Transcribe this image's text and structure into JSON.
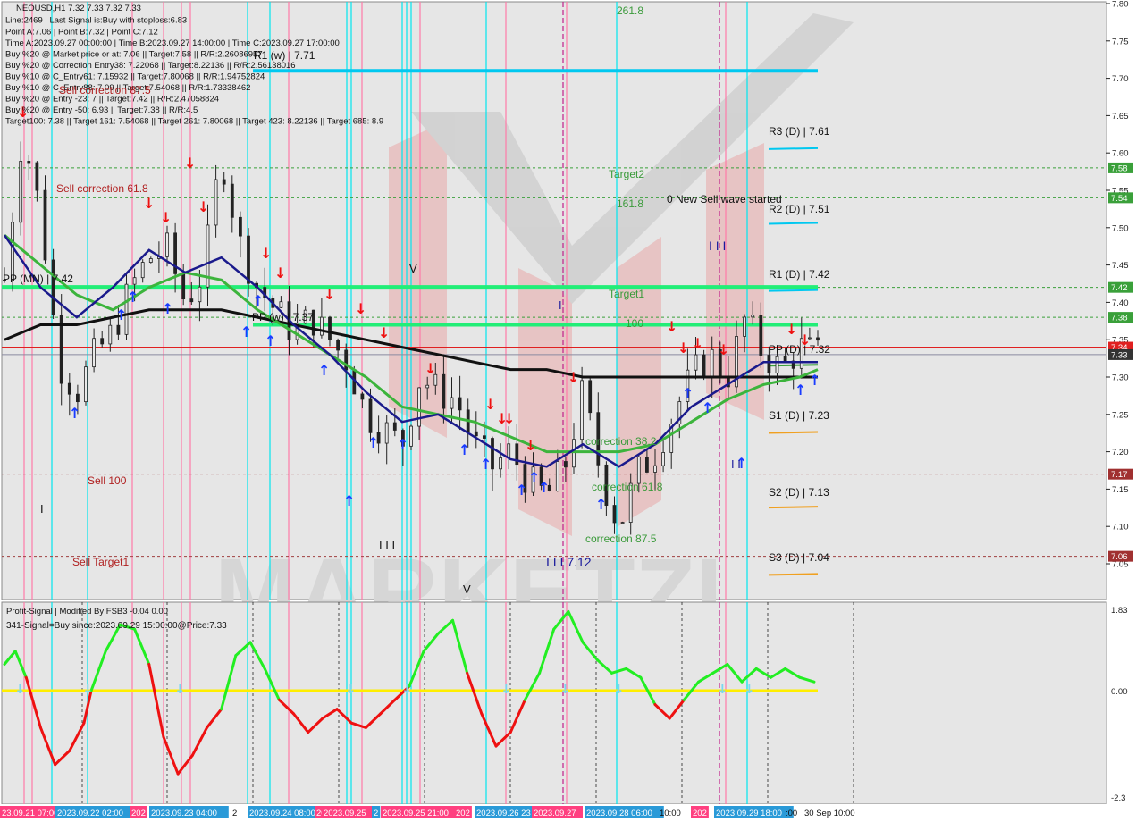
{
  "colors": {
    "background": "#ffffff",
    "pane_bg": "#e3e3e3",
    "ema_fast": "#1a1a8c",
    "ema_mid": "#3cb43c",
    "ema_slow": "#111111",
    "pivot_cyan": "#00c8f0",
    "level_green": "#22ee77",
    "red_line": "#e02020",
    "grey_line": "#8a8aa0",
    "osc_green": "#22ee22",
    "osc_red": "#ee1111",
    "osc_zero": "#ffee00",
    "vline_cyan": "#00e5ee",
    "vline_pink": "#ff7aa8",
    "vline_magenta": "#c0208a",
    "dotted_line": "#a04040"
  },
  "header": {
    "symbol_line": "NEOUSD,H1  7.32 7.33 7.32 7.33",
    "info_lines": [
      "Line:2469 | Last Signal is:Buy with stoploss:6.83",
      "Point A:7.06 | Point B:7.32 | Point C:7.12",
      "Time A:2023.09.27 00:00:00 | Time B:2023.09.27 14:00:00 | Time C:2023.09.27 17:00:00",
      "Buy %20 @ Market price or at: 7.06 || Target:7.58 || R/R:2.26086957",
      "Buy %20 @ Correction Entry38: 7.22068 || Target:8.22136 || R/R:2.56138016",
      "Buy %10 @ C_Entry61: 7.15932 || Target:7.80068 || R/R:1.94752824",
      "Buy %10 @ C_Entry88: 7.09 || Target:7.54068 || R/R:1.73338462",
      "Buy %20 @ Entry -23: 7 || Target:7.42 || R/R:2.47058824",
      "Buy %20 @ Entry -50: 6.93 || Target:7.38 || R/R:4.5",
      "Target100: 7.38 || Target 161: 7.54068 || Target 261: 7.80068 || Target 423: 8.22136 || Target 685: 8.9"
    ]
  },
  "annotations": {
    "label_261": "261.8",
    "label_target2": "Target2",
    "label_1618": "161.8",
    "label_new_sell": "0 New Sell wave started",
    "label_target1": "Target1",
    "label_100": "100",
    "label_sell_corr_618": "Sell correction 61.8",
    "label_sell_corr_87": "Sell correction 87.5",
    "label_sell_100": "Sell 100",
    "label_sell_target1": "Sell Target1",
    "label_pp_mn": "PP (MN) | 7.42",
    "label_r1_w": "R1 (w) | 7.71",
    "label_pp_w": "PP (w) | 7.37",
    "label_r3_d": "R3 (D) | 7.61",
    "label_r2_d": "R2 (D) | 7.51",
    "label_r1_d": "R1 (D) | 7.42",
    "label_pp_d": "PP (D) | 7.32",
    "label_s1_d": "S1 (D) | 7.23",
    "label_s2_d": "S2 (D) | 7.13",
    "label_s3_d": "S3 (D) | 7.04",
    "label_corr_382": "correction 38.2",
    "label_corr_618": "correction 61.8",
    "label_corr_875": "correction 87.5",
    "label_wave_c": "I I I 7.12",
    "label_wave_iii": "I I I",
    "label_wave_iii_2": "I I I",
    "label_wave_v_top": "V",
    "label_wave_v_bot": "V",
    "label_wave_i": "I",
    "label_wave_ii": "I I",
    "label_tick_left": "I",
    "watermark": "MARKETZI"
  },
  "price_axis": {
    "ticks": [
      "7.80",
      "7.75",
      "7.70",
      "7.65",
      "7.60",
      "7.55",
      "7.50",
      "7.45",
      "7.40",
      "7.35",
      "7.30",
      "7.25",
      "7.20",
      "7.15",
      "7.10",
      "7.05"
    ],
    "badges": [
      {
        "label": "7.58",
        "color": "#3aa03a"
      },
      {
        "label": "7.54",
        "color": "#3aa03a"
      },
      {
        "label": "7.42",
        "color": "#3aa03a"
      },
      {
        "label": "7.38",
        "color": "#3aa03a"
      },
      {
        "label": "7.34",
        "color": "#e02020"
      },
      {
        "label": "7.33",
        "color": "#333333"
      },
      {
        "label": "7.17",
        "color": "#a03030"
      },
      {
        "label": "7.06",
        "color": "#a03030"
      }
    ]
  },
  "oscillator": {
    "title": "Profit-Signal | Modified By FSB3 -0.04 0.00",
    "signal_text": "341-Signal=Buy since:2023.09.29 15:00:00@Price:7.33",
    "axis_ticks": [
      "1.83",
      "0.00",
      "-2.3"
    ]
  },
  "time_axis": {
    "labels": [
      "23.09.21 07:00",
      "2023.09.22 02:00",
      "202",
      "2023.09.23 04:00",
      "2",
      "2023.09.24 08:00",
      "20",
      "2023.09.25",
      "2",
      "2023.09.25 21:00",
      "202",
      "2023.09.26 23",
      "2023.09.27",
      "2023.09.28 06:00",
      "10:00",
      "202",
      "2023.09.29 18:00",
      ":00",
      "30 Sep 10:00"
    ]
  },
  "chart_data": [
    {
      "type": "line",
      "title": "NEOUSD,H1",
      "xlabel": "",
      "ylabel": "",
      "ylim": [
        7.02,
        7.81
      ],
      "x_range": [
        0,
        225
      ],
      "grid": false,
      "series": [
        {
          "name": "NEOUSD,H1",
          "kind": "candles-close",
          "x": [
            0,
            5,
            10,
            15,
            20,
            25,
            30,
            35,
            40,
            45,
            50,
            55,
            60,
            65,
            70,
            75,
            80,
            85,
            90,
            95,
            100,
            105,
            110,
            115,
            120,
            125,
            130,
            135,
            140,
            145,
            150,
            155,
            160,
            165,
            170,
            175,
            180,
            185,
            190,
            195,
            200,
            205,
            210,
            215,
            220,
            225
          ],
          "values": [
            7.43,
            7.63,
            7.52,
            7.32,
            7.28,
            7.33,
            7.36,
            7.42,
            7.46,
            7.47,
            7.4,
            7.44,
            7.6,
            7.48,
            7.42,
            7.39,
            7.36,
            7.38,
            7.35,
            7.32,
            7.25,
            7.23,
            7.21,
            7.3,
            7.28,
            7.27,
            7.21,
            7.18,
            7.2,
            7.16,
            7.14,
            7.18,
            7.28,
            7.17,
            7.1,
            7.17,
            7.2,
            7.25,
            7.3,
            7.33,
            7.3,
            7.38,
            7.33,
            7.31,
            7.34,
            7.33
          ]
        },
        {
          "kind": "ema-fast",
          "x": [
            0,
            10,
            20,
            30,
            40,
            50,
            60,
            70,
            80,
            90,
            100,
            110,
            120,
            130,
            140,
            150,
            160,
            170,
            180,
            190,
            200,
            210,
            220,
            225
          ],
          "values": [
            7.49,
            7.42,
            7.38,
            7.42,
            7.47,
            7.44,
            7.46,
            7.42,
            7.37,
            7.33,
            7.28,
            7.24,
            7.25,
            7.22,
            7.19,
            7.18,
            7.21,
            7.18,
            7.21,
            7.26,
            7.29,
            7.32,
            7.32,
            7.32
          ]
        },
        {
          "kind": "ema-mid",
          "x": [
            0,
            10,
            20,
            30,
            40,
            50,
            60,
            70,
            80,
            90,
            100,
            110,
            120,
            130,
            140,
            150,
            160,
            170,
            180,
            190,
            200,
            210,
            220,
            225
          ],
          "values": [
            7.49,
            7.45,
            7.41,
            7.39,
            7.42,
            7.44,
            7.43,
            7.39,
            7.36,
            7.33,
            7.3,
            7.26,
            7.25,
            7.24,
            7.22,
            7.2,
            7.2,
            7.2,
            7.21,
            7.24,
            7.27,
            7.29,
            7.3,
            7.31
          ]
        },
        {
          "kind": "ema-slow",
          "x": [
            0,
            10,
            20,
            30,
            40,
            50,
            60,
            70,
            80,
            90,
            100,
            110,
            120,
            130,
            140,
            150,
            160,
            170,
            180,
            190,
            200,
            210,
            220,
            225
          ],
          "values": [
            7.35,
            7.37,
            7.37,
            7.38,
            7.39,
            7.39,
            7.39,
            7.38,
            7.37,
            7.36,
            7.35,
            7.34,
            7.33,
            7.32,
            7.31,
            7.31,
            7.3,
            7.3,
            7.3,
            7.3,
            7.3,
            7.3,
            7.3,
            7.3
          ]
        }
      ]
    },
    {
      "type": "line",
      "title": "Profit-Signal | Modified By FSB3 -0.04 0.00",
      "xlabel": "",
      "ylabel": "",
      "ylim": [
        -2.3,
        1.83
      ],
      "x_range": [
        0,
        225
      ],
      "series": [
        {
          "kind": "signal",
          "x": [
            0,
            3,
            6,
            10,
            14,
            18,
            22,
            24,
            28,
            32,
            36,
            40,
            44,
            48,
            52,
            56,
            60,
            64,
            68,
            72,
            76,
            80,
            84,
            88,
            92,
            96,
            100,
            104,
            108,
            112,
            116,
            120,
            124,
            128,
            132,
            136,
            140,
            144,
            148,
            152,
            156,
            160,
            164,
            168,
            172,
            176,
            180,
            184,
            188,
            192,
            196,
            200,
            204,
            208,
            212,
            216,
            220,
            224
          ],
          "values": [
            0.6,
            0.9,
            0.3,
            -0.8,
            -1.6,
            -1.3,
            -0.7,
            0,
            0.9,
            1.5,
            1.4,
            0.6,
            -1.0,
            -1.8,
            -1.4,
            -0.8,
            -0.4,
            0.8,
            1.1,
            0.5,
            -0.2,
            -0.5,
            -0.9,
            -0.6,
            -0.4,
            -0.7,
            -0.8,
            -0.5,
            -0.2,
            0.1,
            0.9,
            1.3,
            1.6,
            0.4,
            -0.5,
            -1.2,
            -0.9,
            -0.2,
            0.4,
            1.4,
            1.8,
            1.1,
            0.7,
            0.4,
            0.5,
            0.3,
            -0.3,
            -0.6,
            -0.2,
            0.2,
            0.4,
            0.6,
            0.2,
            0.5,
            0.3,
            0.5,
            0.3,
            0.2
          ]
        }
      ]
    }
  ]
}
